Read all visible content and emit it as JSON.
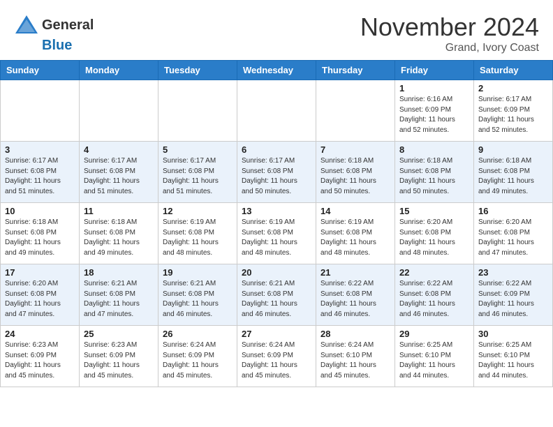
{
  "header": {
    "logo_line1": "General",
    "logo_line2": "Blue",
    "month_title": "November 2024",
    "location": "Grand, Ivory Coast"
  },
  "weekdays": [
    "Sunday",
    "Monday",
    "Tuesday",
    "Wednesday",
    "Thursday",
    "Friday",
    "Saturday"
  ],
  "weeks": [
    [
      {
        "day": "",
        "info": ""
      },
      {
        "day": "",
        "info": ""
      },
      {
        "day": "",
        "info": ""
      },
      {
        "day": "",
        "info": ""
      },
      {
        "day": "",
        "info": ""
      },
      {
        "day": "1",
        "info": "Sunrise: 6:16 AM\nSunset: 6:09 PM\nDaylight: 11 hours\nand 52 minutes."
      },
      {
        "day": "2",
        "info": "Sunrise: 6:17 AM\nSunset: 6:09 PM\nDaylight: 11 hours\nand 52 minutes."
      }
    ],
    [
      {
        "day": "3",
        "info": "Sunrise: 6:17 AM\nSunset: 6:08 PM\nDaylight: 11 hours\nand 51 minutes."
      },
      {
        "day": "4",
        "info": "Sunrise: 6:17 AM\nSunset: 6:08 PM\nDaylight: 11 hours\nand 51 minutes."
      },
      {
        "day": "5",
        "info": "Sunrise: 6:17 AM\nSunset: 6:08 PM\nDaylight: 11 hours\nand 51 minutes."
      },
      {
        "day": "6",
        "info": "Sunrise: 6:17 AM\nSunset: 6:08 PM\nDaylight: 11 hours\nand 50 minutes."
      },
      {
        "day": "7",
        "info": "Sunrise: 6:18 AM\nSunset: 6:08 PM\nDaylight: 11 hours\nand 50 minutes."
      },
      {
        "day": "8",
        "info": "Sunrise: 6:18 AM\nSunset: 6:08 PM\nDaylight: 11 hours\nand 50 minutes."
      },
      {
        "day": "9",
        "info": "Sunrise: 6:18 AM\nSunset: 6:08 PM\nDaylight: 11 hours\nand 49 minutes."
      }
    ],
    [
      {
        "day": "10",
        "info": "Sunrise: 6:18 AM\nSunset: 6:08 PM\nDaylight: 11 hours\nand 49 minutes."
      },
      {
        "day": "11",
        "info": "Sunrise: 6:18 AM\nSunset: 6:08 PM\nDaylight: 11 hours\nand 49 minutes."
      },
      {
        "day": "12",
        "info": "Sunrise: 6:19 AM\nSunset: 6:08 PM\nDaylight: 11 hours\nand 48 minutes."
      },
      {
        "day": "13",
        "info": "Sunrise: 6:19 AM\nSunset: 6:08 PM\nDaylight: 11 hours\nand 48 minutes."
      },
      {
        "day": "14",
        "info": "Sunrise: 6:19 AM\nSunset: 6:08 PM\nDaylight: 11 hours\nand 48 minutes."
      },
      {
        "day": "15",
        "info": "Sunrise: 6:20 AM\nSunset: 6:08 PM\nDaylight: 11 hours\nand 48 minutes."
      },
      {
        "day": "16",
        "info": "Sunrise: 6:20 AM\nSunset: 6:08 PM\nDaylight: 11 hours\nand 47 minutes."
      }
    ],
    [
      {
        "day": "17",
        "info": "Sunrise: 6:20 AM\nSunset: 6:08 PM\nDaylight: 11 hours\nand 47 minutes."
      },
      {
        "day": "18",
        "info": "Sunrise: 6:21 AM\nSunset: 6:08 PM\nDaylight: 11 hours\nand 47 minutes."
      },
      {
        "day": "19",
        "info": "Sunrise: 6:21 AM\nSunset: 6:08 PM\nDaylight: 11 hours\nand 46 minutes."
      },
      {
        "day": "20",
        "info": "Sunrise: 6:21 AM\nSunset: 6:08 PM\nDaylight: 11 hours\nand 46 minutes."
      },
      {
        "day": "21",
        "info": "Sunrise: 6:22 AM\nSunset: 6:08 PM\nDaylight: 11 hours\nand 46 minutes."
      },
      {
        "day": "22",
        "info": "Sunrise: 6:22 AM\nSunset: 6:08 PM\nDaylight: 11 hours\nand 46 minutes."
      },
      {
        "day": "23",
        "info": "Sunrise: 6:22 AM\nSunset: 6:09 PM\nDaylight: 11 hours\nand 46 minutes."
      }
    ],
    [
      {
        "day": "24",
        "info": "Sunrise: 6:23 AM\nSunset: 6:09 PM\nDaylight: 11 hours\nand 45 minutes."
      },
      {
        "day": "25",
        "info": "Sunrise: 6:23 AM\nSunset: 6:09 PM\nDaylight: 11 hours\nand 45 minutes."
      },
      {
        "day": "26",
        "info": "Sunrise: 6:24 AM\nSunset: 6:09 PM\nDaylight: 11 hours\nand 45 minutes."
      },
      {
        "day": "27",
        "info": "Sunrise: 6:24 AM\nSunset: 6:09 PM\nDaylight: 11 hours\nand 45 minutes."
      },
      {
        "day": "28",
        "info": "Sunrise: 6:24 AM\nSunset: 6:10 PM\nDaylight: 11 hours\nand 45 minutes."
      },
      {
        "day": "29",
        "info": "Sunrise: 6:25 AM\nSunset: 6:10 PM\nDaylight: 11 hours\nand 44 minutes."
      },
      {
        "day": "30",
        "info": "Sunrise: 6:25 AM\nSunset: 6:10 PM\nDaylight: 11 hours\nand 44 minutes."
      }
    ]
  ]
}
